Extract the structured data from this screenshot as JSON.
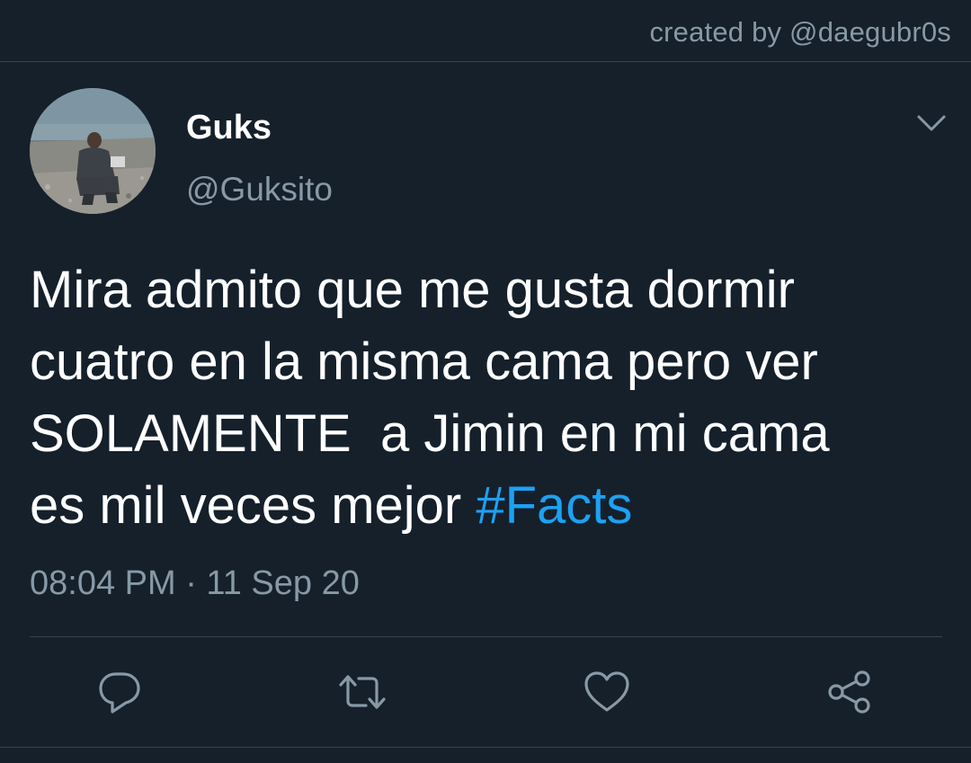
{
  "header": {
    "credit": "created by @daegubr0s"
  },
  "tweet": {
    "display_name": "Guks",
    "handle": "@Guksito",
    "text": "Mira admito que me gusta dormir\ncuatro en la misma cama pero ver\nSOLAMENTE  a Jimin en mi cama\nes mil veces mejor ",
    "hashtag": "#Facts",
    "timestamp": "08:04 PM · 11 Sep 20"
  },
  "actions": [
    {
      "icon": "reply-icon"
    },
    {
      "icon": "retweet-icon"
    },
    {
      "icon": "like-icon"
    },
    {
      "icon": "share-icon"
    }
  ],
  "colors": {
    "background": "#15202b",
    "secondary_text": "#8899a6",
    "link": "#1da1f2",
    "divider": "#38444d"
  }
}
